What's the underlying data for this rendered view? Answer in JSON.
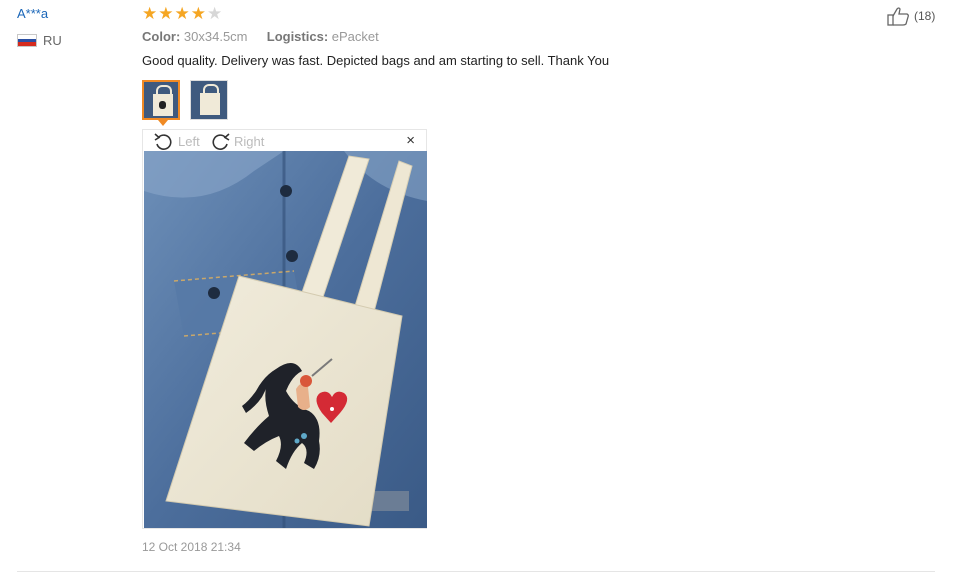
{
  "reviewer": {
    "name": "A***a",
    "country_code": "RU",
    "flag_icon": "russia-flag-icon"
  },
  "rating": {
    "stars": 4,
    "max": 5,
    "filled_color": "#f5a623",
    "empty_color": "#d7d7d7"
  },
  "attributes": {
    "color_label": "Color:",
    "color_value": "30x34.5cm",
    "logistics_label": "Logistics:",
    "logistics_value": "ePacket"
  },
  "review_text": "Good quality. Delivery was fast. Depicted bags and am starting to sell. Thank You",
  "thumbnails": [
    {
      "icon": "tote-bag-photo-thumbnail",
      "selected": true
    },
    {
      "icon": "tote-bag-photo-thumbnail",
      "selected": false
    }
  ],
  "viewer": {
    "rotate_left_label": "Left",
    "rotate_right_label": "Right",
    "close_glyph": "×",
    "image": "tote-bag-on-denim-jacket-photo"
  },
  "date": "12 Oct 2018 21:34",
  "helpful": {
    "icon": "thumbs-up-icon",
    "count_text": "(18)"
  },
  "colors": {
    "username_link": "#1a66b8",
    "accent_orange": "#f08a24",
    "muted_text": "#999999"
  }
}
